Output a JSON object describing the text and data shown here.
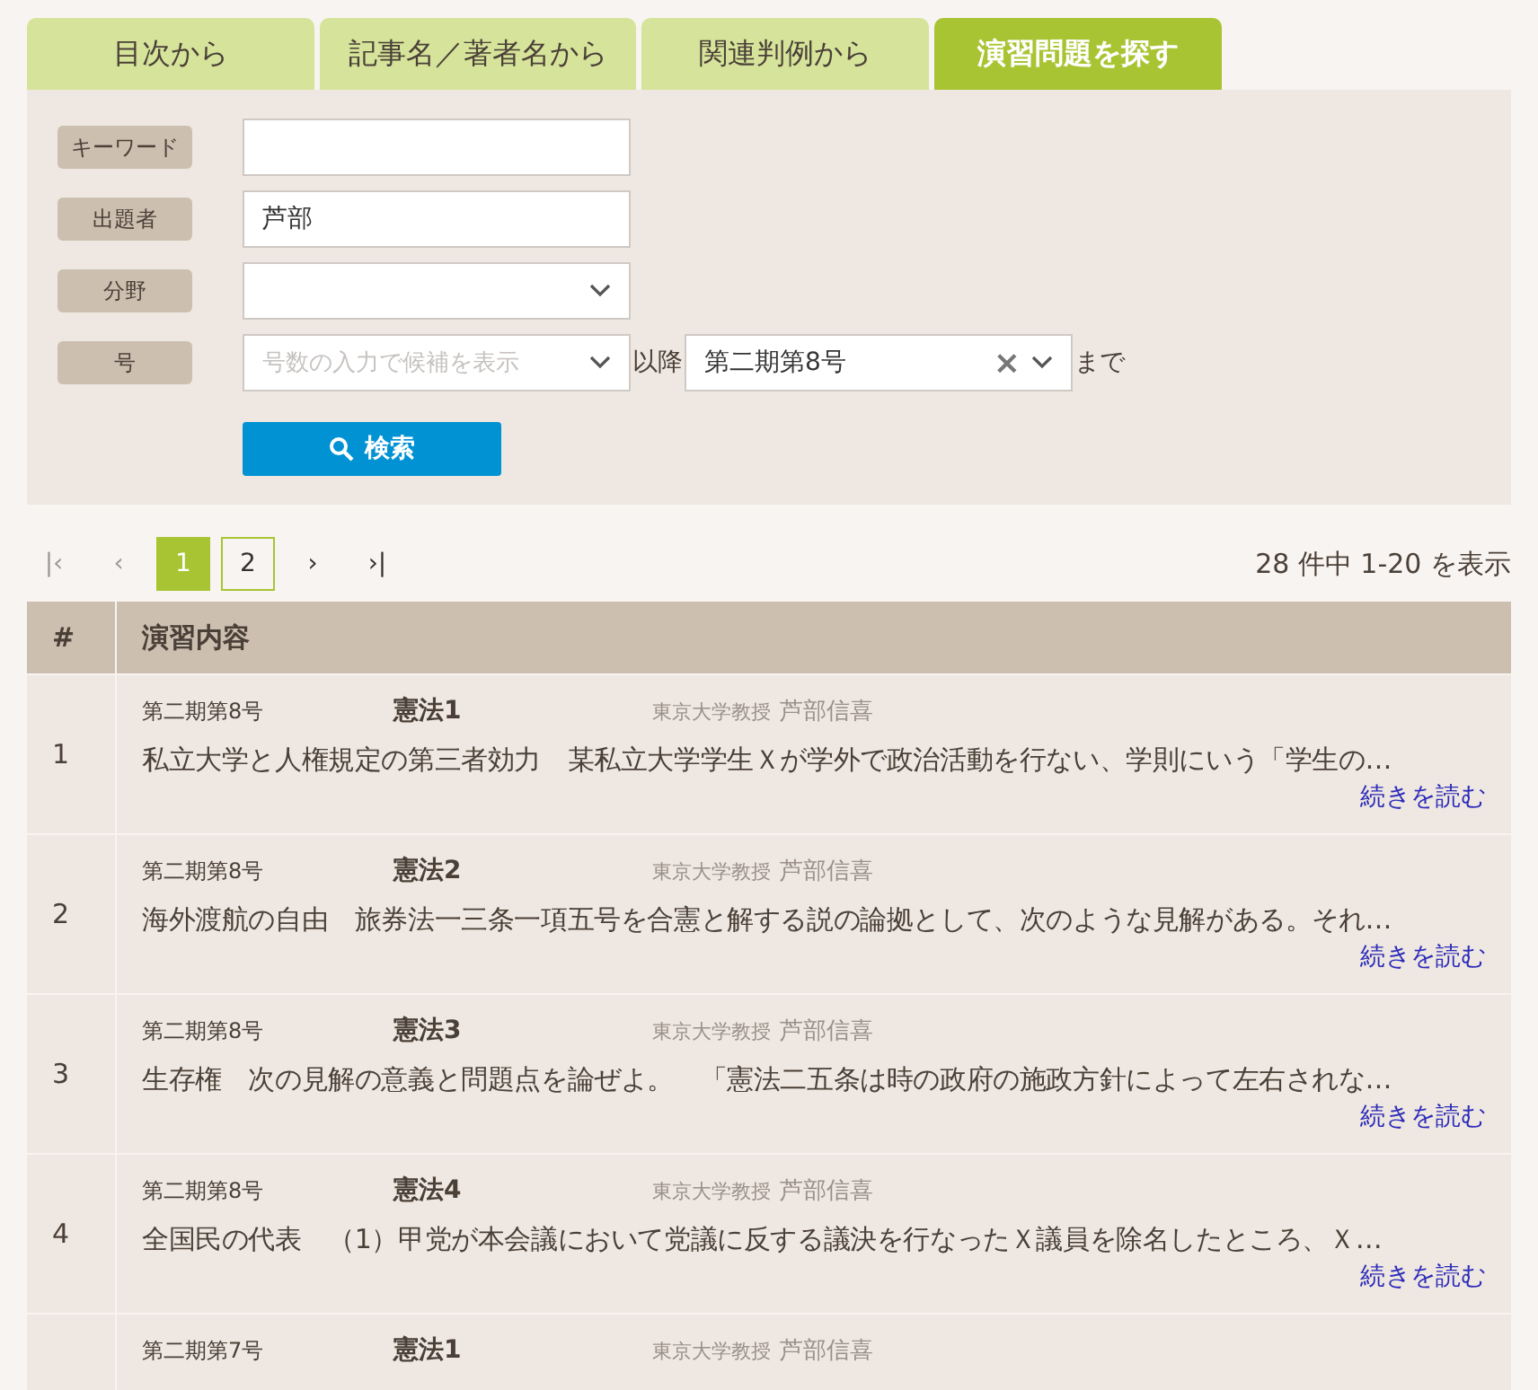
{
  "tabs": [
    {
      "label": "目次から",
      "selected": false
    },
    {
      "label": "記事名／著者名から",
      "selected": false
    },
    {
      "label": "関連判例から",
      "selected": false
    },
    {
      "label": "演習問題を探す",
      "selected": true
    }
  ],
  "form": {
    "fields": [
      {
        "label": "キーワード",
        "kind": "text"
      },
      {
        "label": "出題者",
        "kind": "text",
        "value": "芦部"
      },
      {
        "label": "分野",
        "kind": "select"
      },
      {
        "label": "号",
        "kind": "range",
        "placeholder": "号数の入力で候補を表示",
        "between": "以降",
        "to_value": "第二期第8号",
        "to_clear": "×",
        "after": "まで"
      }
    ],
    "search_button": "検索"
  },
  "pagination": {
    "first": "|‹",
    "prev": "‹",
    "pages": [
      {
        "label": "1",
        "selected": true
      },
      {
        "label": "2",
        "selected": false
      }
    ],
    "next": "›",
    "last": "›|",
    "summary": "28 件中 1-20 を表示"
  },
  "table": {
    "columns": [
      "#",
      "演習内容"
    ],
    "rows": [
      {
        "number": "1",
        "issue": "第二期第8号",
        "subject": "憲法1",
        "author_title": "東京大学教授",
        "author": "芦部信喜",
        "text": "私立大学と人権規定の第三者効力　某私立大学学生Ｘが学外で政治活動を行ない、学則にいう「学生の…",
        "link": "続きを読む"
      },
      {
        "number": "2",
        "issue": "第二期第8号",
        "subject": "憲法2",
        "author_title": "東京大学教授",
        "author": "芦部信喜",
        "text": "海外渡航の自由　旅券法一三条一項五号を合憲と解する説の論拠として、次のような見解がある。それ…",
        "link": "続きを読む"
      },
      {
        "number": "3",
        "issue": "第二期第8号",
        "subject": "憲法3",
        "author_title": "東京大学教授",
        "author": "芦部信喜",
        "text": "生存権　次の見解の意義と問題点を論ぜよ。　「憲法二五条は時の政府の施政方針によって左右されな…",
        "link": "続きを読む"
      },
      {
        "number": "4",
        "issue": "第二期第8号",
        "subject": "憲法4",
        "author_title": "東京大学教授",
        "author": "芦部信喜",
        "text": "全国民の代表　（1）甲党が本会議において党議に反する議決を行なったＸ議員を除名したところ、Ｘ…",
        "link": "続きを読む"
      },
      {
        "issue": "第二期第7号",
        "subject": "憲法1",
        "author_title": "東京大学教授",
        "author": "芦部信喜"
      }
    ]
  }
}
